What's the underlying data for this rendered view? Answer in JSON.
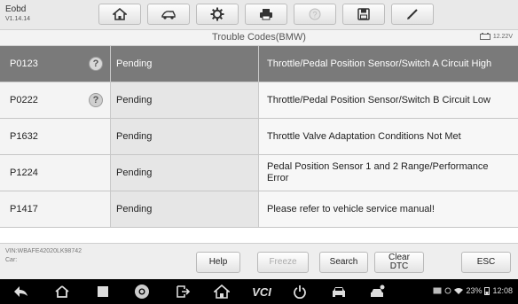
{
  "app": {
    "name": "Eobd",
    "version": "V1.14.14"
  },
  "toolbar_icons": [
    "home-icon",
    "vehicle-swap-icon",
    "settings-gear-icon",
    "print-icon",
    "help-icon",
    "save-icon",
    "edit-pen-icon"
  ],
  "subheader": {
    "title": "Trouble Codes(BMW)",
    "voltage": "12.22V"
  },
  "rows": [
    {
      "code": "P0123",
      "status": "Pending",
      "description": "Throttle/Pedal Position Sensor/Switch A Circuit High",
      "help": true,
      "selected": true
    },
    {
      "code": "P0222",
      "status": "Pending",
      "description": "Throttle/Pedal Position Sensor/Switch B Circuit Low",
      "help": true,
      "selected": false
    },
    {
      "code": "P1632",
      "status": "Pending",
      "description": "Throttle Valve Adaptation Conditions Not Met",
      "help": false,
      "selected": false
    },
    {
      "code": "P1224",
      "status": "Pending",
      "description": "Pedal Position Sensor 1 and 2 Range/Performance Error",
      "help": false,
      "selected": false
    },
    {
      "code": "P1417",
      "status": "Pending",
      "description": "Please refer to vehicle service manual!",
      "help": false,
      "selected": false
    }
  ],
  "footer": {
    "vin": "VIN:WBAFE42020LK98742",
    "car": "Car:",
    "buttons": {
      "help": "Help",
      "freeze": "Freeze",
      "search": "Search",
      "clear_line1": "Clear",
      "clear_line2": "DTC",
      "esc": "ESC"
    }
  },
  "navbar": {
    "vci_label": "VCI",
    "battery": "23%",
    "time": "12:08"
  }
}
